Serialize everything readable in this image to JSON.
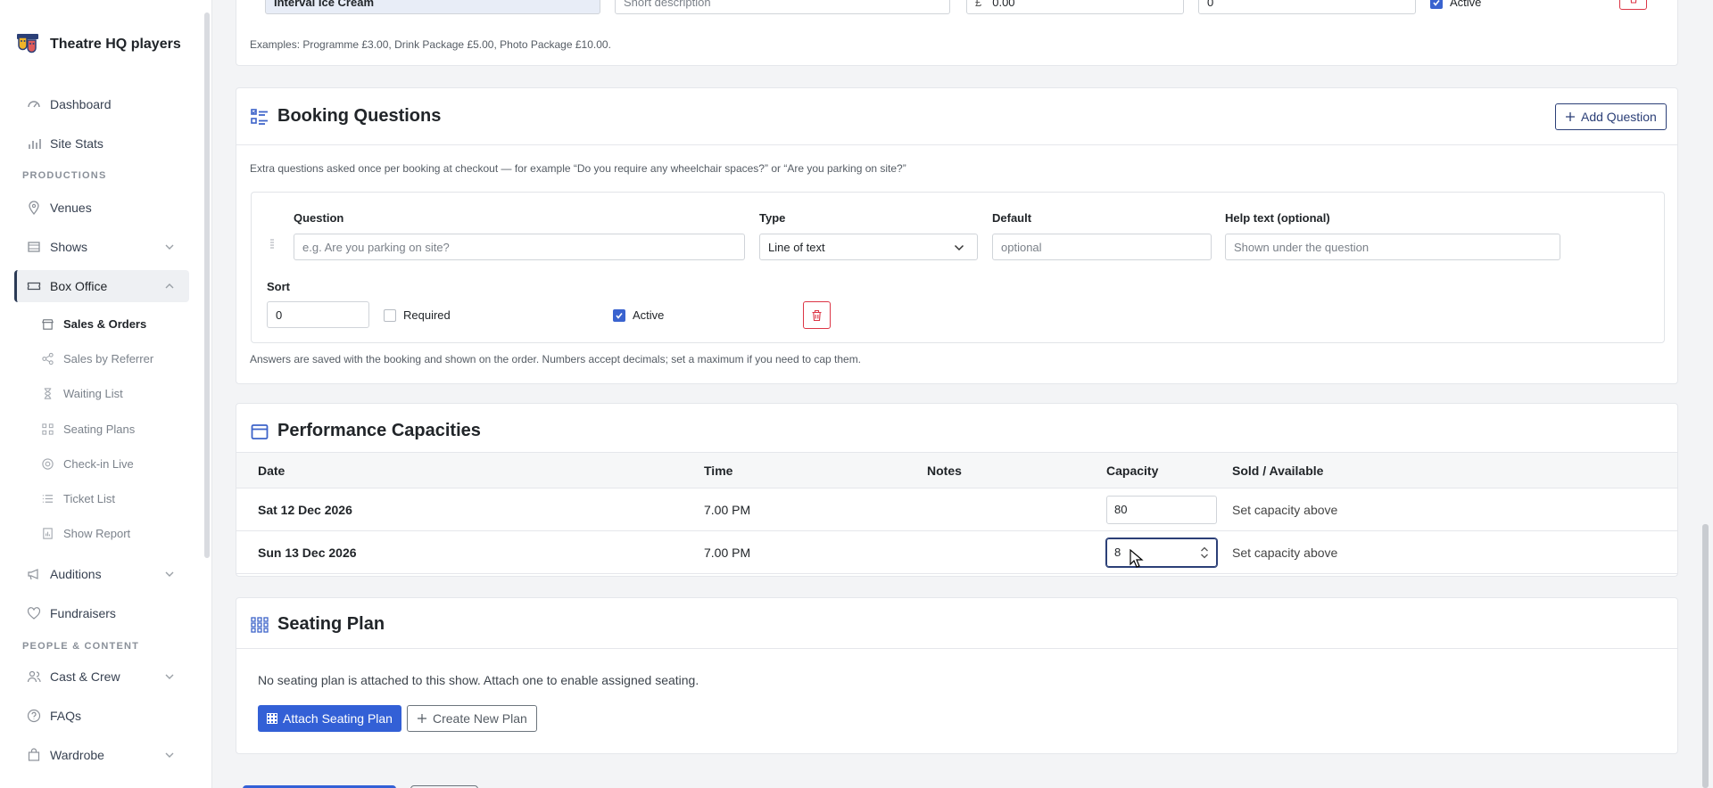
{
  "app": {
    "name": "Theatre HQ players"
  },
  "sidebar": {
    "items_top": [
      {
        "label": "Dashboard",
        "icon": "dashboard-icon"
      },
      {
        "label": "Site Stats",
        "icon": "bar-chart-icon"
      }
    ],
    "section_productions": "PRODUCTIONS",
    "productions": [
      {
        "label": "Venues",
        "icon": "map-pin-icon"
      },
      {
        "label": "Shows",
        "icon": "film-icon"
      },
      {
        "label": "Box Office",
        "icon": "ticket-icon"
      }
    ],
    "box_office_sub": [
      {
        "label": "Sales & Orders",
        "icon": "store-icon"
      },
      {
        "label": "Sales by Referrer",
        "icon": "share-icon"
      },
      {
        "label": "Waiting List",
        "icon": "hourglass-icon"
      },
      {
        "label": "Seating Plans",
        "icon": "grid-icon"
      },
      {
        "label": "Check-in Live",
        "icon": "camera-icon"
      },
      {
        "label": "Ticket List",
        "icon": "list-icon"
      },
      {
        "label": "Show Report",
        "icon": "report-icon"
      }
    ],
    "more": [
      {
        "label": "Auditions",
        "icon": "megaphone-icon"
      },
      {
        "label": "Fundraisers",
        "icon": "heart-icon"
      }
    ],
    "section_people": "PEOPLE & CONTENT",
    "people": [
      {
        "label": "Cast & Crew",
        "icon": "users-icon"
      },
      {
        "label": "FAQs",
        "icon": "help-icon"
      },
      {
        "label": "Wardrobe",
        "icon": "bag-icon"
      }
    ]
  },
  "extras": {
    "row_name": "Interval Ice Cream",
    "row_desc_placeholder": "Short description",
    "row_price_prefix": "£",
    "row_price": "0.00",
    "row_sort": "0",
    "row_active": "Active",
    "examples": "Examples: Programme £3.00, Drink Package £5.00, Photo Package £10.00."
  },
  "booking": {
    "title": "Booking Questions",
    "add_label": "Add Question",
    "description": "Extra questions asked once per booking at checkout — for example “Do you require any wheelchair spaces?” or “Are you parking on site?”",
    "labels": {
      "question": "Question",
      "type": "Type",
      "default": "Default",
      "help": "Help text (optional)",
      "sort": "Sort"
    },
    "question_placeholder": "e.g. Are you parking on site?",
    "type_value": "Line of text",
    "default_placeholder": "optional",
    "help_placeholder": "Shown under the question",
    "sort_value": "0",
    "required_label": "Required",
    "active_label": "Active",
    "footer": "Answers are saved with the booking and shown on the order. Numbers accept decimals; set a maximum if you need to cap them."
  },
  "capacities": {
    "title": "Performance Capacities",
    "headers": [
      "Date",
      "Time",
      "Notes",
      "Capacity",
      "Sold / Available"
    ],
    "rows": [
      {
        "date": "Sat 12 Dec 2026",
        "time": "7.00 PM",
        "notes": "",
        "capacity": "80",
        "sold": "Set capacity above"
      },
      {
        "date": "Sun 13 Dec 2026",
        "time": "7.00 PM",
        "notes": "",
        "capacity": "8",
        "sold": "Set capacity above"
      }
    ]
  },
  "seating": {
    "title": "Seating Plan",
    "message": "No seating plan is attached to this show. Attach one to enable assigned seating.",
    "attach_label": "Attach Seating Plan",
    "create_label": "Create New Plan"
  }
}
